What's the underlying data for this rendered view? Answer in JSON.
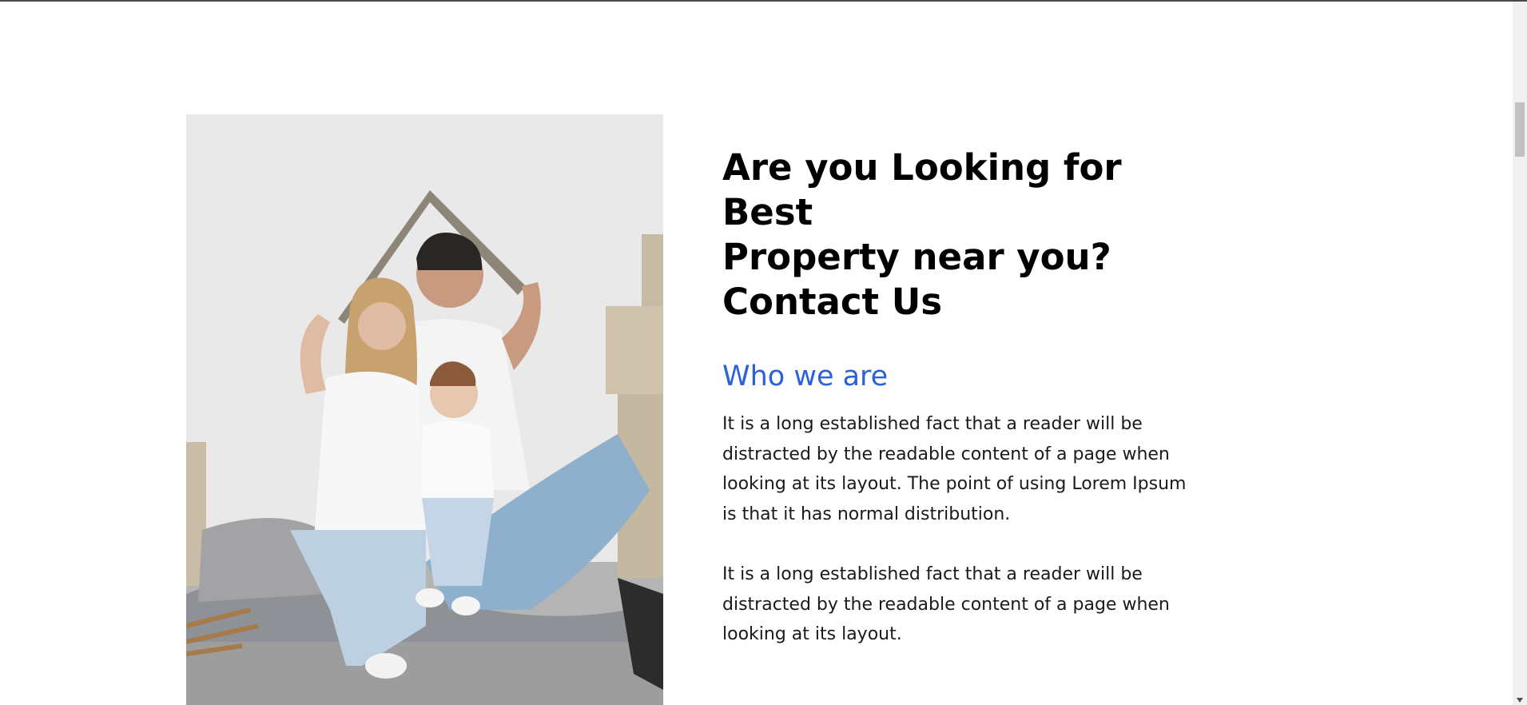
{
  "hero": {
    "image_alt": "Family sitting on the floor under a cardboard roof among moving boxes"
  },
  "about": {
    "headline": "Are you Looking for Best\nProperty near you?\nContact Us",
    "subheading": "Who we are",
    "paragraphs": [
      "It is a long established fact that a reader will be distracted by the readable content of a page when looking at its layout. The point of using Lorem Ipsum is that it has normal distribution.",
      "It is a long established fact that a reader will be distracted by the readable content of a page when looking at its layout."
    ]
  },
  "colors": {
    "accent": "#2b61d9",
    "text": "#000000"
  }
}
